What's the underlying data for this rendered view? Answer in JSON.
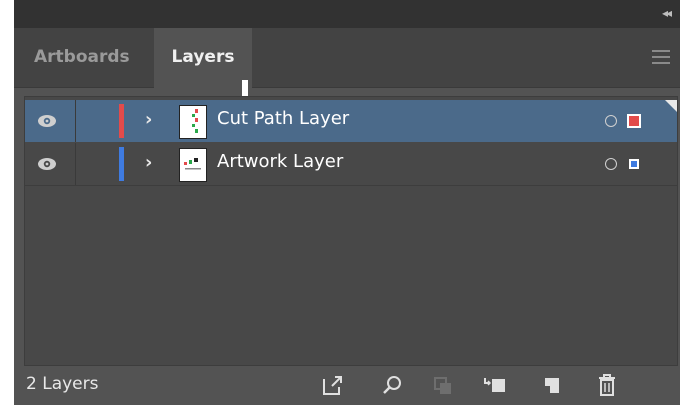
{
  "collapse_icon": "double-chevron-left-icon",
  "tabs": [
    {
      "label": "Artboards"
    },
    {
      "label": "Layers"
    }
  ],
  "layers": [
    {
      "name": "Cut Path Layer",
      "color": "#e24b4b",
      "selected": true
    },
    {
      "name": "Artwork Layer",
      "color": "#3f7be0",
      "selected": false
    }
  ],
  "footer": {
    "count": "2 Layers"
  },
  "icons": {
    "eye": "eye-icon",
    "expand": "chevron-right-icon",
    "target": "target-circle-icon",
    "menu": "hamburger-menu-icon",
    "export": "export-icon",
    "locate": "search-icon",
    "clip": "clipping-mask-icon",
    "sublayer": "new-sublayer-icon",
    "newlayer": "new-layer-icon",
    "delete": "trash-icon"
  },
  "colors": {
    "panel": "#535353",
    "tabbar": "#434343",
    "selected_row": "#4b6a8a"
  }
}
